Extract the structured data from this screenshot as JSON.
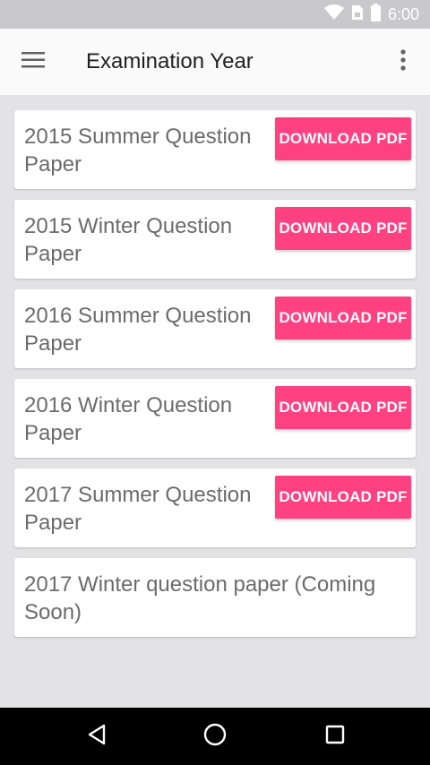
{
  "status_bar": {
    "time": "6:00",
    "icons": [
      "wifi-icon",
      "sim-icon",
      "battery-icon"
    ]
  },
  "app_bar": {
    "title": "Examination Year",
    "menu_icon": "menu-icon",
    "overflow_icon": "more-vert-icon"
  },
  "papers": [
    {
      "title": "2015 Summer Question Paper",
      "button_label": "DOWNLOAD PDF"
    },
    {
      "title": "2015 Winter Question Paper",
      "button_label": "DOWNLOAD PDF"
    },
    {
      "title": "2016 Summer Question Paper",
      "button_label": "DOWNLOAD PDF"
    },
    {
      "title": "2016 Winter Question Paper",
      "button_label": "DOWNLOAD PDF"
    },
    {
      "title": "2017 Summer Question Paper",
      "button_label": "DOWNLOAD PDF"
    },
    {
      "title": "2017 Winter question paper (Coming Soon)"
    }
  ],
  "nav_bar": {
    "icons": [
      "back-icon",
      "home-icon",
      "recents-icon"
    ]
  },
  "colors": {
    "accent": "#ff4081",
    "status_bar": "#c9c9cb",
    "app_bar": "#fafafa",
    "background": "#e3e3e6",
    "nav_bar": "#000000"
  }
}
